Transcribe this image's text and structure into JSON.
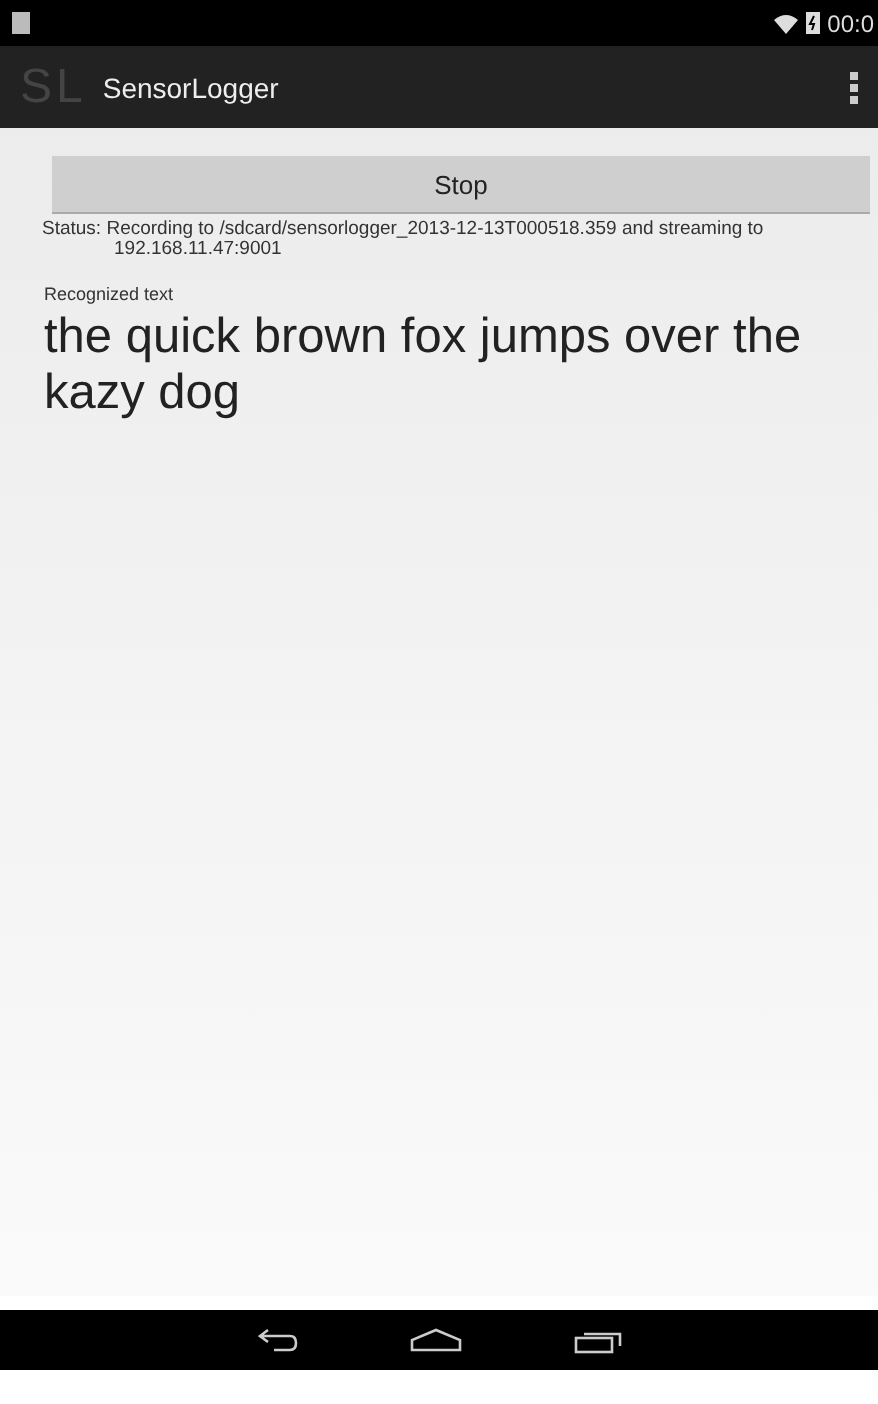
{
  "status_bar": {
    "time": "00:0"
  },
  "action_bar": {
    "logo": "SL",
    "title": "SensorLogger"
  },
  "stop_button": {
    "label": "Stop"
  },
  "status": {
    "text": "Status: Recording to /sdcard/sensorlogger_2013-12-13T000518.359 and streaming to 192.168.11.47:9001"
  },
  "recognized": {
    "label": "Recognized text",
    "text": "the quick brown fox jumps over the kazy dog"
  }
}
